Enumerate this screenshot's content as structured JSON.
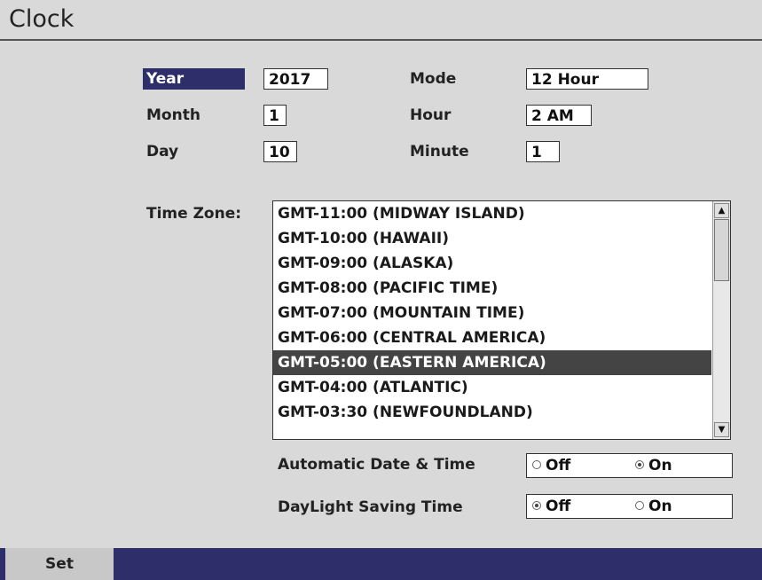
{
  "window": {
    "title": "Clock"
  },
  "datetime": {
    "year": {
      "label": "Year",
      "value": "2017"
    },
    "month": {
      "label": "Month",
      "value": "1"
    },
    "day": {
      "label": "Day",
      "value": "10"
    },
    "mode": {
      "label": "Mode",
      "value": "12 Hour"
    },
    "hour": {
      "label": "Hour",
      "value": "2 AM"
    },
    "minute": {
      "label": "Minute",
      "value": "1"
    }
  },
  "timezone": {
    "label": "Time Zone:",
    "items": [
      "GMT-11:00 (MIDWAY ISLAND)",
      "GMT-10:00 (HAWAII)",
      "GMT-09:00 (ALASKA)",
      "GMT-08:00 (PACIFIC TIME)",
      "GMT-07:00 (MOUNTAIN TIME)",
      "GMT-06:00 (CENTRAL AMERICA)",
      "GMT-05:00 (EASTERN AMERICA)",
      "GMT-04:00 (ATLANTIC)",
      "GMT-03:30 (NEWFOUNDLAND)"
    ],
    "selected": "GMT-05:00 (EASTERN AMERICA)"
  },
  "automatic": {
    "label": "Automatic Date & Time",
    "off": "Off",
    "on": "On",
    "value": "On"
  },
  "daylight": {
    "label": "DayLight Saving Time",
    "off": "Off",
    "on": "On",
    "value": "Off"
  },
  "footer": {
    "set_label": "Set"
  },
  "colors": {
    "highlight": "#2e2e6a",
    "selected_row": "#444444",
    "background": "#d9d9d9"
  }
}
